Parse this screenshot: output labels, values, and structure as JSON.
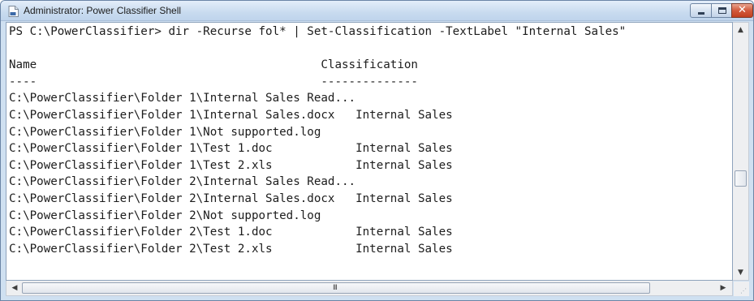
{
  "window": {
    "title": "Administrator: Power Classifier Shell",
    "controls": {
      "minimize_icon": "minimize-icon",
      "maximize_icon": "maximize-icon",
      "close_icon": "close-icon",
      "close_glyph": "✕"
    },
    "colors": {
      "titlebar": "#c8dbef",
      "close_button": "#d25a3c",
      "console_background": "#ffffff",
      "console_text": "#1c1c1c"
    }
  },
  "console": {
    "lines": [
      "PS C:\\PowerClassifier> dir -Recurse fol* | Set-Classification -TextLabel \"Internal Sales\"",
      "",
      "Name                                         Classification",
      "----                                         --------------",
      "C:\\PowerClassifier\\Folder 1\\Internal Sales Read...",
      "C:\\PowerClassifier\\Folder 1\\Internal Sales.docx   Internal Sales",
      "C:\\PowerClassifier\\Folder 1\\Not supported.log",
      "C:\\PowerClassifier\\Folder 1\\Test 1.doc            Internal Sales",
      "C:\\PowerClassifier\\Folder 1\\Test 2.xls            Internal Sales",
      "C:\\PowerClassifier\\Folder 2\\Internal Sales Read...",
      "C:\\PowerClassifier\\Folder 2\\Internal Sales.docx   Internal Sales",
      "C:\\PowerClassifier\\Folder 2\\Not supported.log",
      "C:\\PowerClassifier\\Folder 2\\Test 1.doc            Internal Sales",
      "C:\\PowerClassifier\\Folder 2\\Test 2.xls            Internal Sales"
    ]
  },
  "scrollbars": {
    "up_arrow": "▲",
    "down_arrow": "▼",
    "left_arrow": "◀",
    "right_arrow": "▶",
    "thumb_grip": "III",
    "size_grip": "⋰"
  }
}
